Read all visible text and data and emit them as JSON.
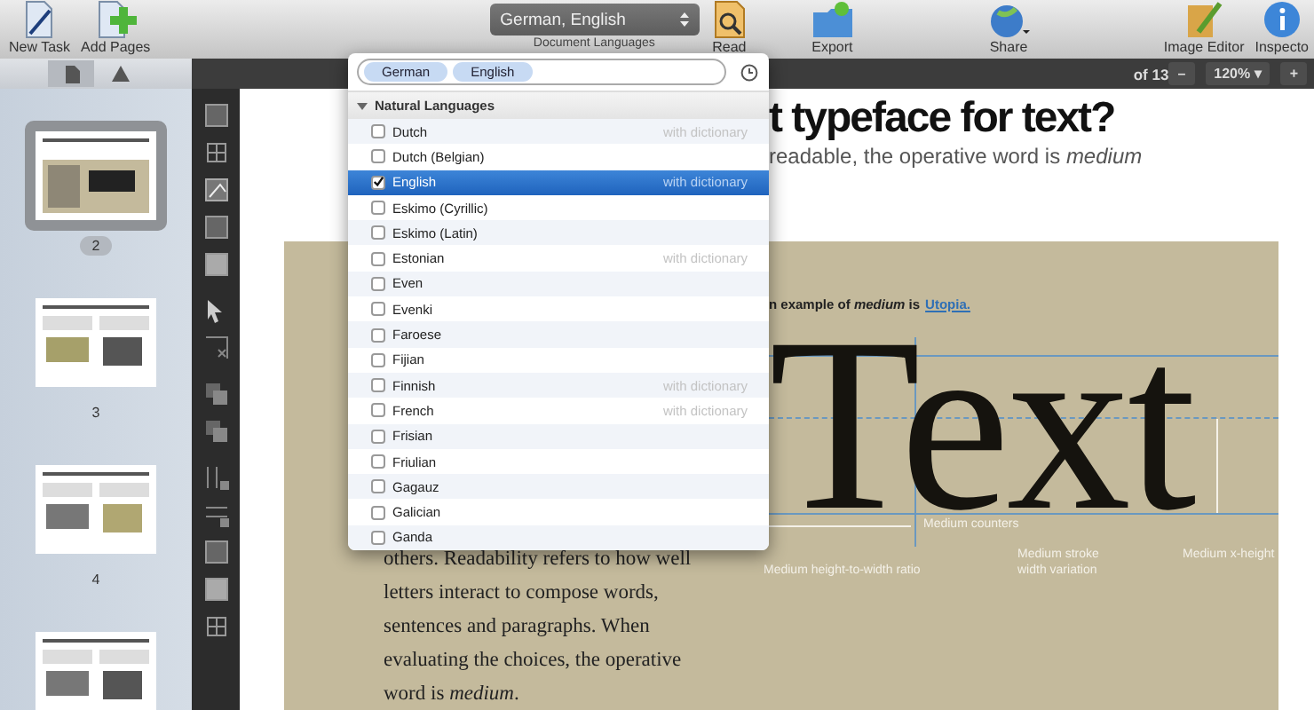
{
  "toolbar": {
    "left": [
      {
        "label": "New Task"
      },
      {
        "label": "Add Pages"
      }
    ],
    "languages": {
      "value": "German, English",
      "label": "Document Languages"
    },
    "right": [
      {
        "label": "Read"
      },
      {
        "label": "Export"
      },
      {
        "label": "Share"
      }
    ],
    "far_right": [
      {
        "label": "Image Editor"
      },
      {
        "label": "Inspecto"
      }
    ]
  },
  "sidebar": {
    "tabs": [
      {
        "selected": true
      },
      {
        "selected": false
      }
    ],
    "pages": [
      {
        "number": "2",
        "selected": true
      },
      {
        "number": "3",
        "selected": false
      },
      {
        "number": "4",
        "selected": false
      },
      {
        "selected": false
      }
    ]
  },
  "page_bar": {
    "count": "of 13",
    "zoom": "120% ▾",
    "zoom_out": "–",
    "zoom_in": "+"
  },
  "document": {
    "heading": "t typeface for text?",
    "subtitle": "readable, the operative word is *medium*",
    "caption": "n example of *medium* is",
    "caption_link": "Utopia.",
    "body": "others. Readability refers to how well letters interact to compose words, sentences and paragraphs. When evaluating the choices, the operative word is *medium*.",
    "specimen": "Text",
    "annotations": [
      "Medium counters",
      "Medium height-to-width ratio",
      "Medium stroke width variation",
      "Medium x-height"
    ]
  },
  "language_popover": {
    "tokens": [
      "German",
      "English"
    ],
    "section": "Natural Languages",
    "expanded": true,
    "languages": [
      {
        "name": "Dutch",
        "checked": false,
        "selected": false,
        "note": "with dictionary"
      },
      {
        "name": "Dutch (Belgian)",
        "checked": false,
        "selected": false
      },
      {
        "name": "English",
        "checked": true,
        "selected": true,
        "note": "with dictionary"
      },
      {
        "name": "Eskimo (Cyrillic)",
        "checked": false,
        "selected": false
      },
      {
        "name": "Eskimo (Latin)",
        "checked": false,
        "selected": false
      },
      {
        "name": "Estonian",
        "checked": false,
        "selected": false,
        "note": "with dictionary"
      },
      {
        "name": "Even",
        "checked": false,
        "selected": false
      },
      {
        "name": "Evenki",
        "checked": false,
        "selected": false
      },
      {
        "name": "Faroese",
        "checked": false,
        "selected": false
      },
      {
        "name": "Fijian",
        "checked": false,
        "selected": false
      },
      {
        "name": "Finnish",
        "checked": false,
        "selected": false,
        "note": "with dictionary"
      },
      {
        "name": "French",
        "checked": false,
        "selected": false,
        "note": "with dictionary"
      },
      {
        "name": "Frisian",
        "checked": false,
        "selected": false
      },
      {
        "name": "Friulian",
        "checked": false,
        "selected": false
      },
      {
        "name": "Gagauz",
        "checked": false,
        "selected": false
      },
      {
        "name": "Galician",
        "checked": false,
        "selected": false
      },
      {
        "name": "Ganda",
        "checked": false,
        "selected": false
      }
    ]
  }
}
